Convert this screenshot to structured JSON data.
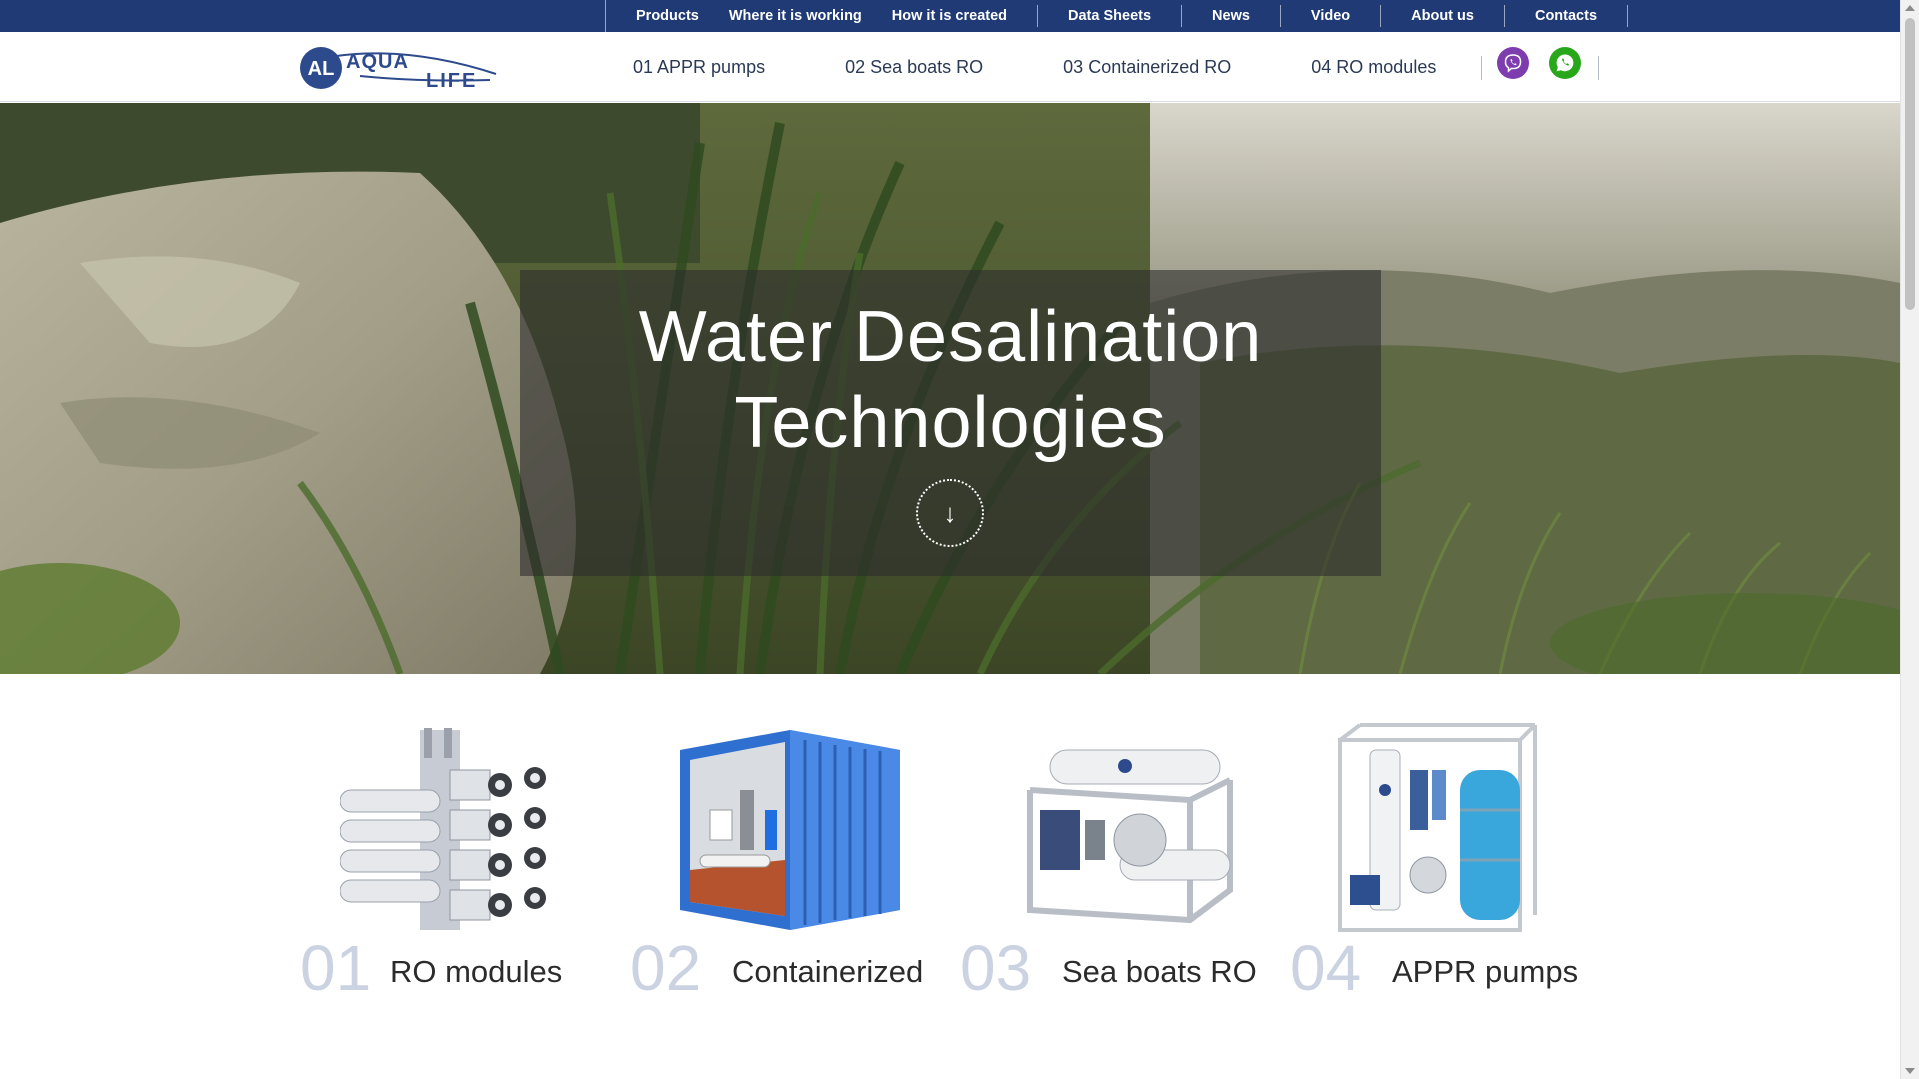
{
  "topnav": {
    "items": [
      {
        "label": "Products"
      },
      {
        "label": "Where it is working"
      },
      {
        "label": "How it is created"
      },
      {
        "label": "Data Sheets"
      },
      {
        "label": "News"
      },
      {
        "label": "Video"
      },
      {
        "label": "About us"
      },
      {
        "label": "Contacts"
      }
    ]
  },
  "header": {
    "logo": {
      "mark": "AL",
      "word1": "AQUA",
      "word2": "LIFE",
      "icon": "aqualife-logo"
    },
    "nav": [
      {
        "label": "01 APPR pumps"
      },
      {
        "label": "02 Sea boats RO"
      },
      {
        "label": "03 Containerized RO"
      },
      {
        "label": "04 RO modules"
      }
    ],
    "social": [
      {
        "icon": "viber-icon",
        "color": "#7d3daf"
      },
      {
        "icon": "whatsapp-icon",
        "color": "#29a71a"
      }
    ]
  },
  "hero": {
    "title_line1": "Water Desalination",
    "title_line2": "Technologies",
    "scroll_arrow": "↓"
  },
  "products": [
    {
      "num": "01",
      "name": "RO modules",
      "icon": "ro-modules-image"
    },
    {
      "num": "02",
      "name": "Containerized",
      "icon": "containerized-image"
    },
    {
      "num": "03",
      "name": "Sea boats RO",
      "icon": "sea-boats-ro-image"
    },
    {
      "num": "04",
      "name": "APPR pumps",
      "icon": "appr-pumps-image"
    }
  ],
  "colors": {
    "topbar": "#1f3a75",
    "accent": "#2a3a55",
    "number": "#cbd3e2"
  }
}
